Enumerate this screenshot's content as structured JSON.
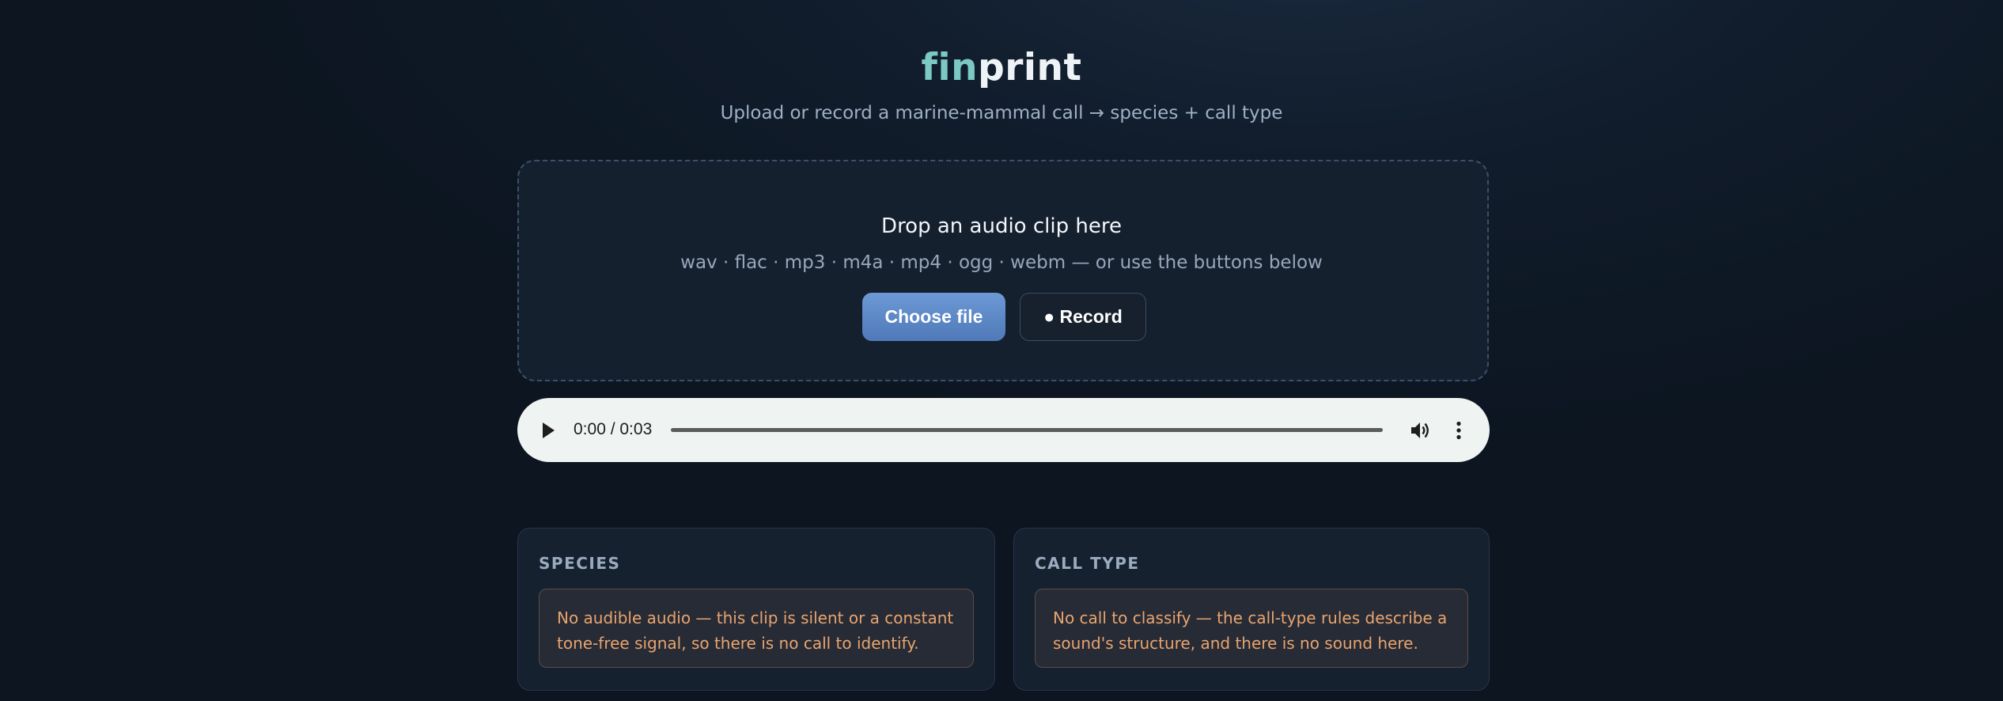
{
  "header": {
    "logo_part1": "fin",
    "logo_part2": "print",
    "subtitle": "Upload or record a marine-mammal call → species + call type"
  },
  "dropzone": {
    "title": "Drop an audio clip here",
    "formats": "wav · flac · mp3 · m4a · mp4 · ogg · webm — or use the buttons below",
    "choose_label": "Choose file",
    "record_label": "● Record"
  },
  "player": {
    "time": "0:00 / 0:03",
    "progress": 0
  },
  "results": {
    "species": {
      "heading": "SPECIES",
      "message": "No audible audio — this clip is silent or a constant tone-free signal, so there is no call to identify."
    },
    "call_type": {
      "heading": "CALL TYPE",
      "message": "No call to classify — the call-type rules describe a sound's structure, and there is no sound here."
    }
  },
  "colors": {
    "accent_teal": "#7cc9c2",
    "primary_button": "#5f8ac7",
    "warning_text": "#e9a46f"
  }
}
